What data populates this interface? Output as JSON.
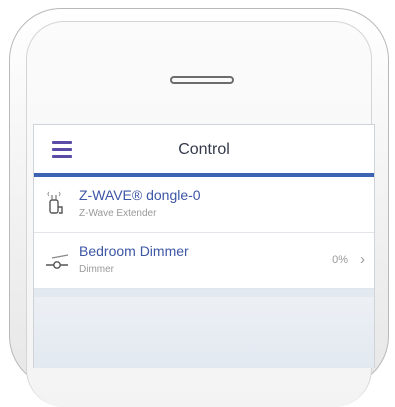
{
  "header": {
    "title": "Control"
  },
  "devices": [
    {
      "name": "Z-WAVE® dongle-0",
      "type": "Z-Wave Extender",
      "value": ""
    },
    {
      "name": "Bedroom Dimmer",
      "type": "Dimmer",
      "value": "0%"
    }
  ],
  "colors": {
    "accent": "#3c63b3",
    "menu": "#5b4aa6",
    "name": "#3d56a6"
  },
  "icons": {
    "menu": "hamburger-menu-icon",
    "dongle": "usb-dongle-icon",
    "dimmer": "dimmer-slider-icon",
    "chevron": "chevron-right-icon"
  }
}
